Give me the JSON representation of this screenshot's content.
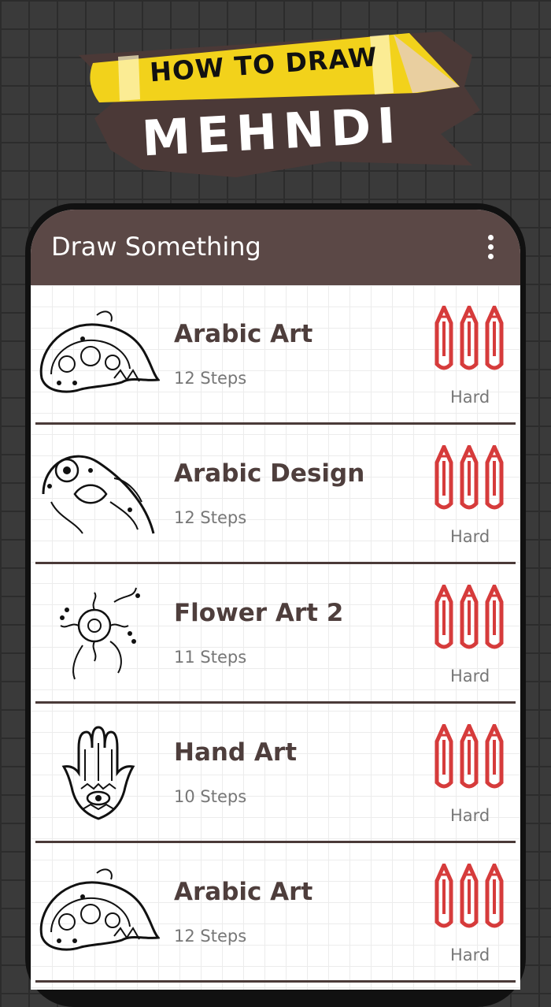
{
  "logo": {
    "title": "HOW TO DRAW",
    "subtitle": "MEHNDI"
  },
  "appbar": {
    "title": "Draw Something",
    "menu_icon": "more-vertical-icon"
  },
  "colors": {
    "appbar": "#5b4846",
    "pencil": "#d63b3b",
    "title_text": "#4e3e3c",
    "pencil_banner": "#f2d21b"
  },
  "items": [
    {
      "title": "Arabic Art",
      "steps": "12 Steps",
      "level": "Hard",
      "thumb_icon": "paisley-mehndi-icon",
      "difficulty_icon": "pencil-icon"
    },
    {
      "title": "Arabic Design",
      "steps": "12 Steps",
      "level": "Hard",
      "thumb_icon": "floral-mehndi-icon",
      "difficulty_icon": "pencil-icon"
    },
    {
      "title": "Flower Art 2",
      "steps": "11 Steps",
      "level": "Hard",
      "thumb_icon": "flower-mehndi-icon",
      "difficulty_icon": "pencil-icon"
    },
    {
      "title": "Hand Art",
      "steps": "10 Steps",
      "level": "Hard",
      "thumb_icon": "hamsa-hand-icon",
      "difficulty_icon": "pencil-icon"
    },
    {
      "title": "Arabic Art",
      "steps": "12 Steps",
      "level": "Hard",
      "thumb_icon": "paisley-mehndi-icon",
      "difficulty_icon": "pencil-icon"
    }
  ]
}
